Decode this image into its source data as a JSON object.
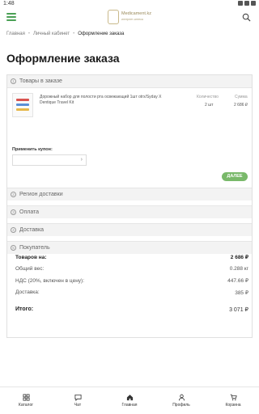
{
  "status": {
    "time": "1:48"
  },
  "header": {
    "logo_name": "Medicament.kz",
    "logo_tagline": "интернет-аптека"
  },
  "breadcrumb": {
    "home": "Главная",
    "account": "Личный кабинет",
    "current": "Оформление заказа"
  },
  "page_title": "Оформление заказа",
  "sections": {
    "cart": {
      "num": "1",
      "title": "Товары в заказе"
    },
    "region": {
      "num": "2",
      "title": "Регион доставки"
    },
    "payment": {
      "num": "3",
      "title": "Оплата"
    },
    "delivery": {
      "num": "4",
      "title": "Доставка"
    },
    "buyer": {
      "num": "5",
      "title": "Покупатель"
    }
  },
  "cart": {
    "col_qty": "Количество",
    "col_sum": "Сумма",
    "item": {
      "name": "Дорожный набор для полости рта освежающий 1шт otrx/Syday X Dentique Travel Kit",
      "qty": "2 шт",
      "sum": "2 686 ₽"
    },
    "coupon_label": "Применить купон:",
    "coupon_value": "",
    "next_label": "ДАЛЕЕ"
  },
  "summary": {
    "items_label": "Товаров на:",
    "items_value": "2 686 ₽",
    "weight_label": "Общий вес:",
    "weight_value": "0.288 кг",
    "vat_label": "НДС (20%, включен в цену):",
    "vat_value": "447.66 ₽",
    "shipping_label": "Доставка:",
    "shipping_value": "385 ₽",
    "total_label": "Итого:",
    "total_value": "3 071 ₽"
  },
  "bottom_nav": [
    {
      "label": "Каталог",
      "icon": "catalog-icon"
    },
    {
      "label": "Чат",
      "icon": "chat-icon"
    },
    {
      "label": "Главная",
      "icon": "home-icon"
    },
    {
      "label": "Профиль",
      "icon": "profile-icon"
    },
    {
      "label": "Корзина",
      "icon": "cart-icon"
    }
  ],
  "colors": {
    "accent": "#4aa055",
    "button": "#79b96a"
  }
}
